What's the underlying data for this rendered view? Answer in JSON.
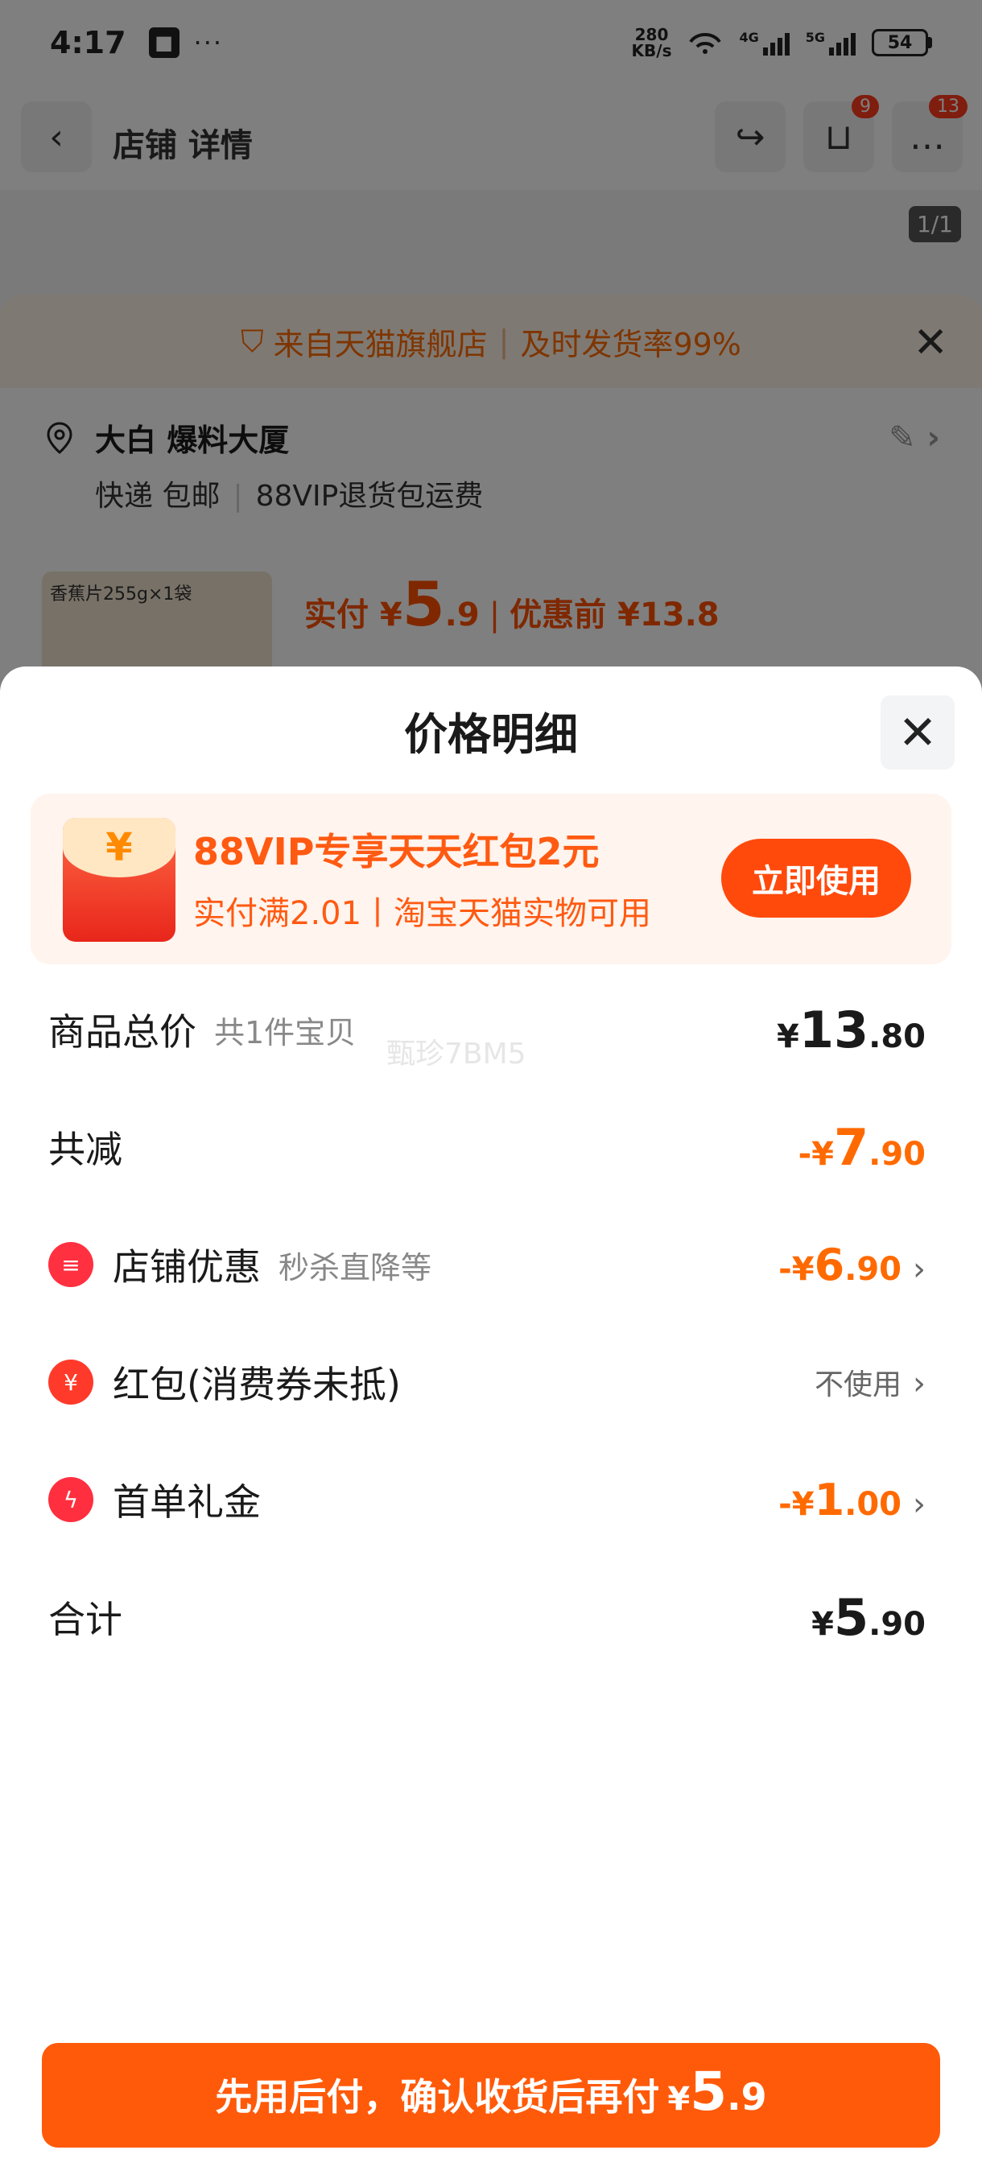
{
  "status_bar": {
    "time": "4:17",
    "dots": "···",
    "net_speed_value": "280",
    "net_speed_unit": "KB/s",
    "signal_1_label": "4G",
    "signal_2_label": "5G",
    "battery": "54"
  },
  "background": {
    "nav_title": "店铺 详情",
    "cart_badge": "9",
    "msg_badge": "13",
    "page_indicator": "1/1",
    "store_banner": {
      "text": "来自天猫旗舰店",
      "separator": "|",
      "rate": "及时发货率99%"
    },
    "address": {
      "name": "大白 爆料大厦",
      "shipping": "快递 包邮",
      "separator": "|",
      "return": "88VIP退货包运费"
    },
    "product_thumb_label": "香蕉片255g×1袋",
    "price_prefix": "实付 ¥",
    "price_int": "5",
    "price_dec": ".9",
    "price_sep": "|",
    "price_before": "优惠前 ¥13.8"
  },
  "sheet": {
    "title": "价格明细",
    "watermark": "甄珍7BM5",
    "promo": {
      "envelope_symbol": "¥",
      "title": "88VIP专享天天红包2元",
      "subtitle": "实付满2.01丨淘宝天猫实物可用",
      "button": "立即使用"
    },
    "rows": {
      "total": {
        "label": "商品总价",
        "sub": "共1件宝贝",
        "cur": "¥",
        "int": "13",
        "dec": ".80"
      },
      "discount": {
        "label": "共减",
        "cur": "-¥",
        "int": "7",
        "dec": ".90"
      },
      "store": {
        "label": "店铺优惠",
        "sub": "秒杀直降等",
        "cur": "-¥",
        "int": "6",
        "dec": ".90",
        "icon_glyph": "≡"
      },
      "redpacket": {
        "label": "红包(消费券未抵)",
        "value": "不使用",
        "icon_glyph": "¥"
      },
      "firstorder": {
        "label": "首单礼金",
        "cur": "-¥",
        "int": "1",
        "dec": ".00",
        "icon_glyph": "ϟ"
      },
      "sum": {
        "label": "合计",
        "cur": "¥",
        "int": "5",
        "dec": ".90"
      }
    },
    "bottom_button": {
      "text": "先用后付，确认收货后再付",
      "cur": "¥",
      "int": "5",
      "dec": ".9"
    }
  },
  "colors": {
    "accent": "#ff5a0a",
    "promo_bg": "#fff4ee",
    "discount_text": "#ff6a00"
  },
  "icons": [
    "chevron-left-icon",
    "share-icon",
    "cart-icon",
    "message-icon",
    "shield-icon",
    "close-icon",
    "location-pin-icon",
    "edit-icon",
    "chevron-right-icon",
    "store-icon",
    "red-packet-icon",
    "lightning-icon",
    "wifi-icon",
    "signal-icon",
    "battery-icon"
  ]
}
